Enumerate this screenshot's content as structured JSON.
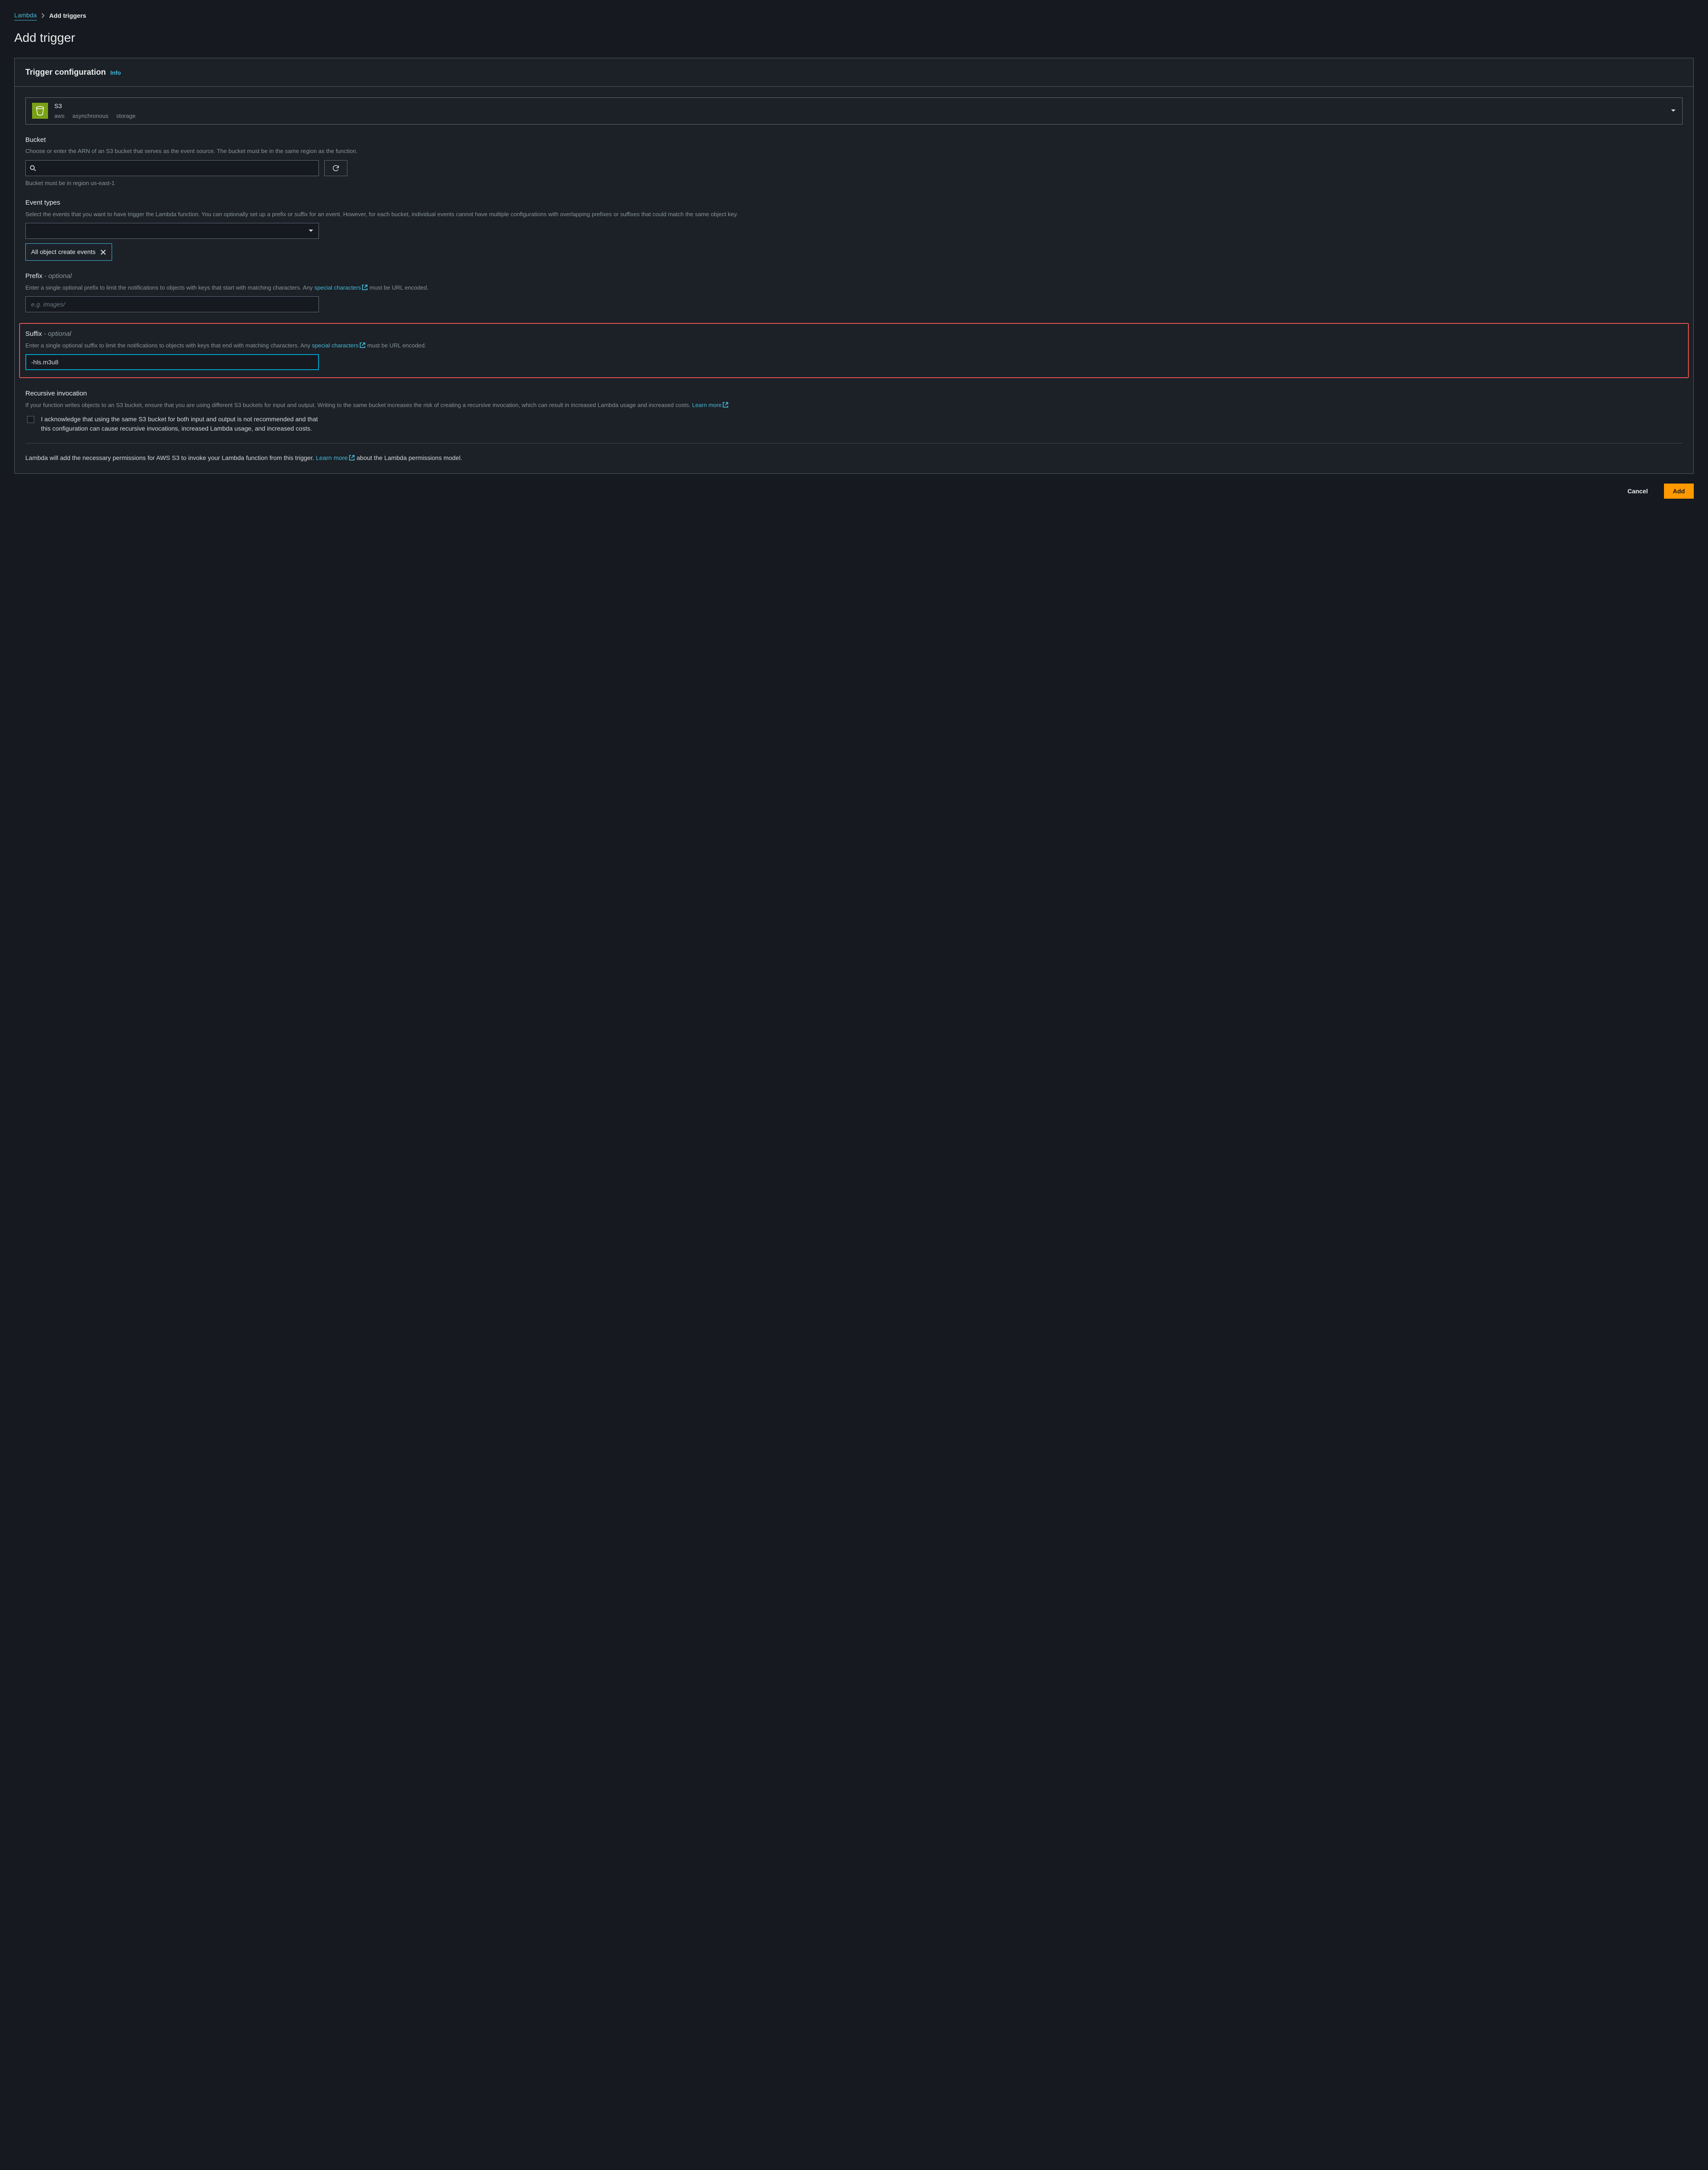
{
  "breadcrumb": {
    "root": "Lambda",
    "current": "Add triggers"
  },
  "page_title": "Add trigger",
  "panel": {
    "title": "Trigger configuration",
    "info": "Info"
  },
  "source": {
    "title": "S3",
    "tags": [
      "aws",
      "asynchronous",
      "storage"
    ]
  },
  "bucket": {
    "label": "Bucket",
    "desc": "Choose or enter the ARN of an S3 bucket that serves as the event source. The bucket must be in the same region as the function.",
    "value": "",
    "hint": "Bucket must be in region us-east-1"
  },
  "event_types": {
    "label": "Event types",
    "desc": "Select the events that you want to have trigger the Lambda function. You can optionally set up a prefix or suffix for an event. However, for each bucket, individual events cannot have multiple configurations with overlapping prefixes or suffixes that could match the same object key.",
    "selected_chip": "All object create events"
  },
  "prefix": {
    "label": "Prefix",
    "optional": "- optional",
    "desc_before": "Enter a single optional prefix to limit the notifications to objects with keys that start with matching characters. Any ",
    "link": "special characters",
    "desc_after": " must be URL encoded.",
    "placeholder": "e.g. images/",
    "value": ""
  },
  "suffix": {
    "label": "Suffix",
    "optional": "- optional",
    "desc_before": "Enter a single optional suffix to limit the notifications to objects with keys that end with matching characters. Any ",
    "link": "special characters",
    "desc_after": " must be URL encoded.",
    "value": "-hls.m3u8"
  },
  "recursive": {
    "label": "Recursive invocation",
    "desc_before": "If your function writes objects to an S3 bucket, ensure that you are using different S3 buckets for input and output. Writing to the same bucket increases the risk of creating a recursive invocation, which can result in increased Lambda usage and increased costs. ",
    "link": "Learn more",
    "ack": "I acknowledge that using the same S3 bucket for both input and output is not recommended and that this configuration can cause recursive invocations, increased Lambda usage, and increased costs."
  },
  "permissions": {
    "text_before": "Lambda will add the necessary permissions for AWS S3 to invoke your Lambda function from this trigger. ",
    "link": "Learn more",
    "text_after": " about the Lambda permissions model."
  },
  "footer": {
    "cancel": "Cancel",
    "add": "Add"
  }
}
